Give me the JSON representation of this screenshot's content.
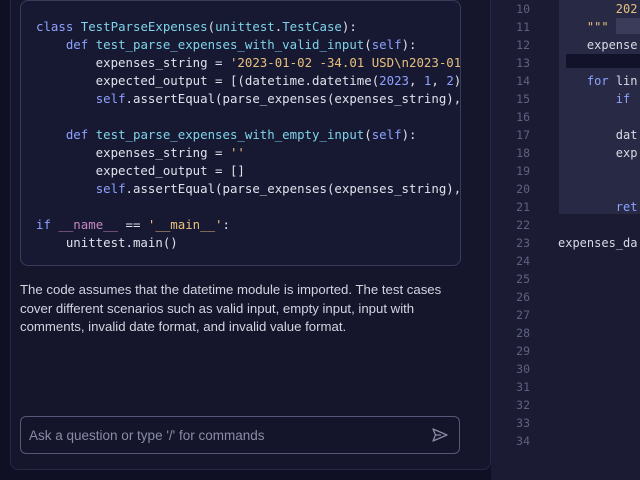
{
  "code_block": {
    "lines": [
      [
        {
          "t": "class ",
          "c": "kw"
        },
        {
          "t": "TestParseExpenses",
          "c": "cls"
        },
        {
          "t": "(",
          "c": ""
        },
        {
          "t": "unittest",
          "c": "cls"
        },
        {
          "t": ".",
          "c": ""
        },
        {
          "t": "TestCase",
          "c": "cls"
        },
        {
          "t": "):",
          "c": ""
        }
      ],
      [
        {
          "t": "    ",
          "c": ""
        },
        {
          "t": "def ",
          "c": "kw"
        },
        {
          "t": "test_parse_expenses_with_valid_input",
          "c": "fn"
        },
        {
          "t": "(",
          "c": ""
        },
        {
          "t": "self",
          "c": "self"
        },
        {
          "t": "):",
          "c": ""
        }
      ],
      [
        {
          "t": "        expenses_string = ",
          "c": ""
        },
        {
          "t": "'2023-01-02 -34.01 USD\\n2023-01-03",
          "c": "str"
        }
      ],
      [
        {
          "t": "        expected_output = [(datetime.datetime(",
          "c": ""
        },
        {
          "t": "2023",
          "c": "kw"
        },
        {
          "t": ", ",
          "c": ""
        },
        {
          "t": "1",
          "c": "kw"
        },
        {
          "t": ", ",
          "c": ""
        },
        {
          "t": "2",
          "c": "kw"
        },
        {
          "t": ")",
          "c": ""
        }
      ],
      [
        {
          "t": "        ",
          "c": ""
        },
        {
          "t": "self",
          "c": "self"
        },
        {
          "t": ".assertEqual(parse_expenses(expenses_string),",
          "c": ""
        }
      ],
      [
        {
          "t": "",
          "c": ""
        }
      ],
      [
        {
          "t": "    ",
          "c": ""
        },
        {
          "t": "def ",
          "c": "kw"
        },
        {
          "t": "test_parse_expenses_with_empty_input",
          "c": "fn"
        },
        {
          "t": "(",
          "c": ""
        },
        {
          "t": "self",
          "c": "self"
        },
        {
          "t": "):",
          "c": ""
        }
      ],
      [
        {
          "t": "        expenses_string = ",
          "c": ""
        },
        {
          "t": "''",
          "c": "str"
        }
      ],
      [
        {
          "t": "        expected_output = []",
          "c": ""
        }
      ],
      [
        {
          "t": "        ",
          "c": ""
        },
        {
          "t": "self",
          "c": "self"
        },
        {
          "t": ".assertEqual(parse_expenses(expenses_string),",
          "c": ""
        }
      ],
      [
        {
          "t": "",
          "c": ""
        }
      ],
      [
        {
          "t": "if ",
          "c": "kw"
        },
        {
          "t": "__name__",
          "c": "dunder"
        },
        {
          "t": " == ",
          "c": ""
        },
        {
          "t": "'__main__'",
          "c": "str"
        },
        {
          "t": ":",
          "c": ""
        }
      ],
      [
        {
          "t": "    unittest.main()",
          "c": ""
        }
      ]
    ]
  },
  "message": {
    "text": "The code assumes that the datetime module is imported. The test cases cover different scenarios such as valid input, empty input, input with comments, invalid date format, and invalid value format."
  },
  "input": {
    "placeholder": "Ask a question or type '/' for commands"
  },
  "icons": {
    "send": "send-icon"
  },
  "editor": {
    "line_numbers": [
      "10",
      "11",
      "12",
      "13",
      "14",
      "15",
      "16",
      "17",
      "18",
      "19",
      "20",
      "21",
      "22",
      "23",
      "24",
      "25",
      "26",
      "27",
      "28",
      "29",
      "30",
      "31",
      "32",
      "33",
      "34"
    ],
    "lines": [
      [
        {
          "t": "        202",
          "c": "str"
        }
      ],
      [
        {
          "t": "    ",
          "c": ""
        },
        {
          "t": "\"\"\"",
          "c": "str"
        }
      ],
      [
        {
          "t": "    expense",
          "c": ""
        }
      ],
      [
        {
          "t": "",
          "c": ""
        }
      ],
      [
        {
          "t": "    ",
          "c": ""
        },
        {
          "t": "for ",
          "c": "kw"
        },
        {
          "t": "lin",
          "c": ""
        }
      ],
      [
        {
          "t": "        ",
          "c": ""
        },
        {
          "t": "if",
          "c": "kw"
        }
      ],
      [
        {
          "t": "",
          "c": ""
        }
      ],
      [
        {
          "t": "        dat",
          "c": ""
        }
      ],
      [
        {
          "t": "        exp",
          "c": ""
        }
      ],
      [
        {
          "t": "",
          "c": ""
        }
      ],
      [
        {
          "t": "",
          "c": ""
        }
      ],
      [
        {
          "t": "        ",
          "c": ""
        },
        {
          "t": "ret",
          "c": "kw"
        }
      ],
      [
        {
          "t": "",
          "c": ""
        }
      ],
      [
        {
          "t": "expenses_da",
          "c": ""
        }
      ]
    ]
  },
  "colors": {
    "background": "#0f1023",
    "panel": "#15162b",
    "editor": "#1b1c33",
    "keyword": "#8ea2ff",
    "function": "#7fd3e8",
    "string": "#e8c07d"
  }
}
